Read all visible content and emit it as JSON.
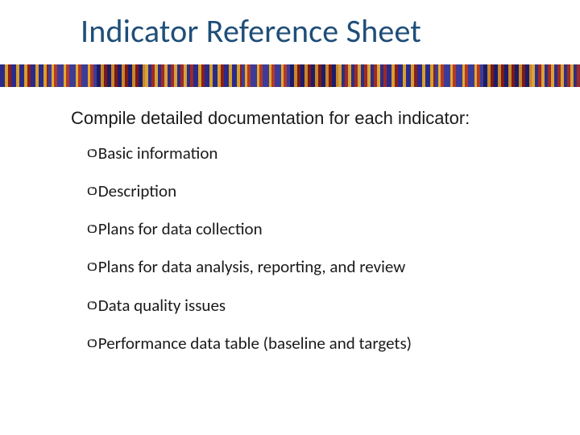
{
  "title": "Indicator Reference Sheet",
  "subtitle": "Compile detailed documentation for each indicator:",
  "bullet_glyph": "cↄ",
  "bullets": [
    {
      "text": "Basic information"
    },
    {
      "text": "Description"
    },
    {
      "text": "Plans for data collection"
    },
    {
      "text": "Plans for data analysis, reporting, and review"
    },
    {
      "text": "Data quality issues"
    },
    {
      "text": "Performance data table (baseline and targets)"
    }
  ]
}
